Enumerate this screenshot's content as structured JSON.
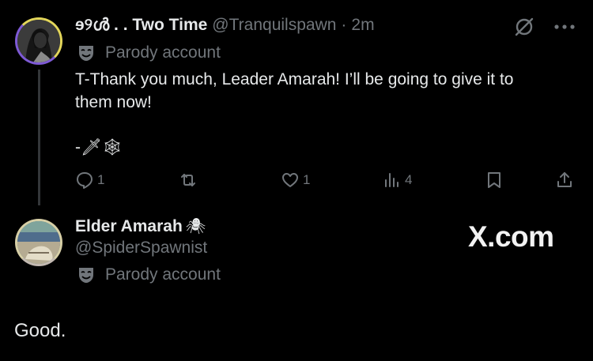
{
  "tweet1": {
    "display_name": "ɘ୨ൾ . . Two Time",
    "handle": "@Tranquilspawn",
    "separator": "·",
    "time": "2m",
    "parody_label": "Parody account",
    "text_line1": "T-Thank you much, Leader Amarah! I’ll be going to give it to",
    "text_line2": "them now!",
    "text_line3": "-🗡🕸",
    "actions": {
      "reply_count": "1",
      "retweet_count": "",
      "like_count": "1",
      "views_count": "4"
    }
  },
  "tweet2": {
    "display_name": "Elder Amarah",
    "name_emoji": "🕷",
    "handle": "@SpiderSpawnist",
    "parody_label": "Parody account",
    "text": "Good."
  },
  "watermark": "X.com",
  "colors": {
    "background": "#000000",
    "primary_text": "#e7e9ea",
    "secondary_text": "#71767b"
  }
}
